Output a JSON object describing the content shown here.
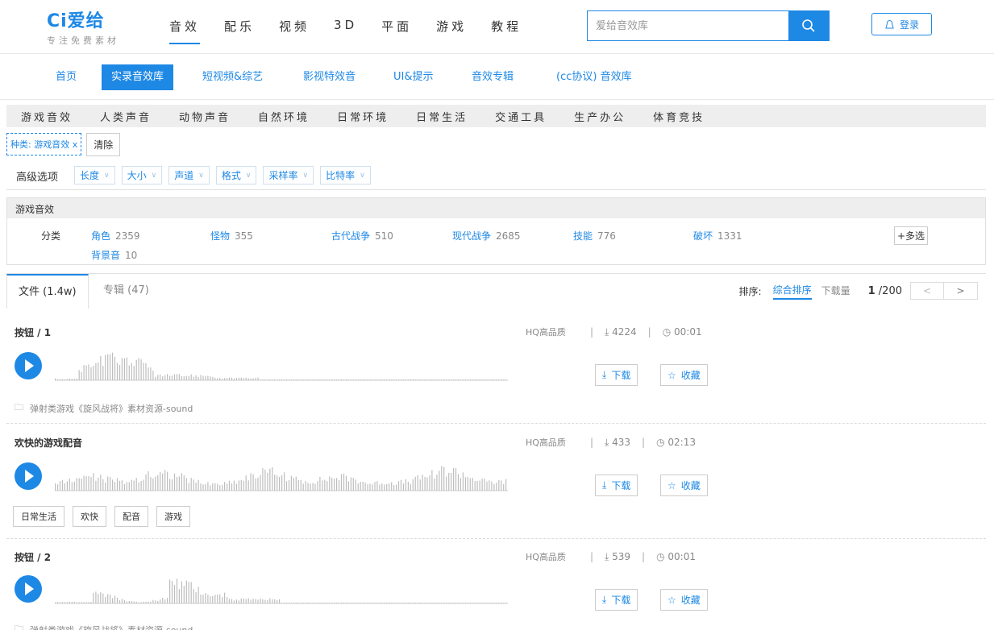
{
  "header": {
    "logo": "Ci爱给",
    "slogan": "专注免费素材",
    "nav": [
      "音效",
      "配乐",
      "视频",
      "3D",
      "平面",
      "游戏",
      "教程"
    ],
    "search_placeholder": "爱给音效库",
    "login_label": "登录",
    "accent_color": "#1e88e5"
  },
  "subnav": [
    "首页",
    "实录音效库",
    "短视频&综艺",
    "影视特效音",
    "UI&提示",
    "音效专辑",
    "(cc协议) 音效库"
  ],
  "categories": [
    "游戏音效",
    "人类声音",
    "动物声音",
    "自然环境",
    "日常环境",
    "日常生活",
    "交通工具",
    "生产办公",
    "体育竞技"
  ],
  "filter": {
    "chip": "种类: 游戏音效 x",
    "clear": "清除"
  },
  "advanced": {
    "label": "高级选项",
    "options": [
      "长度",
      "大小",
      "声道",
      "格式",
      "采样率",
      "比特率"
    ]
  },
  "subpanel": {
    "title": "游戏音效",
    "label": "分类",
    "items": [
      {
        "name": "角色",
        "count": "2359"
      },
      {
        "name": "怪物",
        "count": "355"
      },
      {
        "name": "古代战争",
        "count": "510"
      },
      {
        "name": "现代战争",
        "count": "2685"
      },
      {
        "name": "技能",
        "count": "776"
      },
      {
        "name": "破坏",
        "count": "1331"
      },
      {
        "name": "背景音",
        "count": "10"
      }
    ],
    "multi": "+多选"
  },
  "tabs": {
    "files": "文件 (1.4w)",
    "albums": "专辑 (47)",
    "sort_label": "排序:",
    "sort_options": [
      "综合排序",
      "下载量"
    ],
    "page_current": "1",
    "page_total": "/200"
  },
  "sounds": [
    {
      "title": "按钮 / 1",
      "quality": "HQ高品质",
      "downloads": "4224",
      "duration": "00:01",
      "source": "弹射类游戏《旋风战将》素材资源-sound",
      "tags": []
    },
    {
      "title": "欢快的游戏配音",
      "quality": "HQ高品质",
      "downloads": "433",
      "duration": "02:13",
      "source": "",
      "tags": [
        "日常生活",
        "欢快",
        "配音",
        "游戏"
      ]
    },
    {
      "title": "按钮 / 2",
      "quality": "HQ高品质",
      "downloads": "539",
      "duration": "00:01",
      "source": "弹射类游戏《旋风战将》素材资源-sound",
      "tags": []
    }
  ],
  "actions": {
    "download": "下载",
    "favorite": "收藏"
  }
}
